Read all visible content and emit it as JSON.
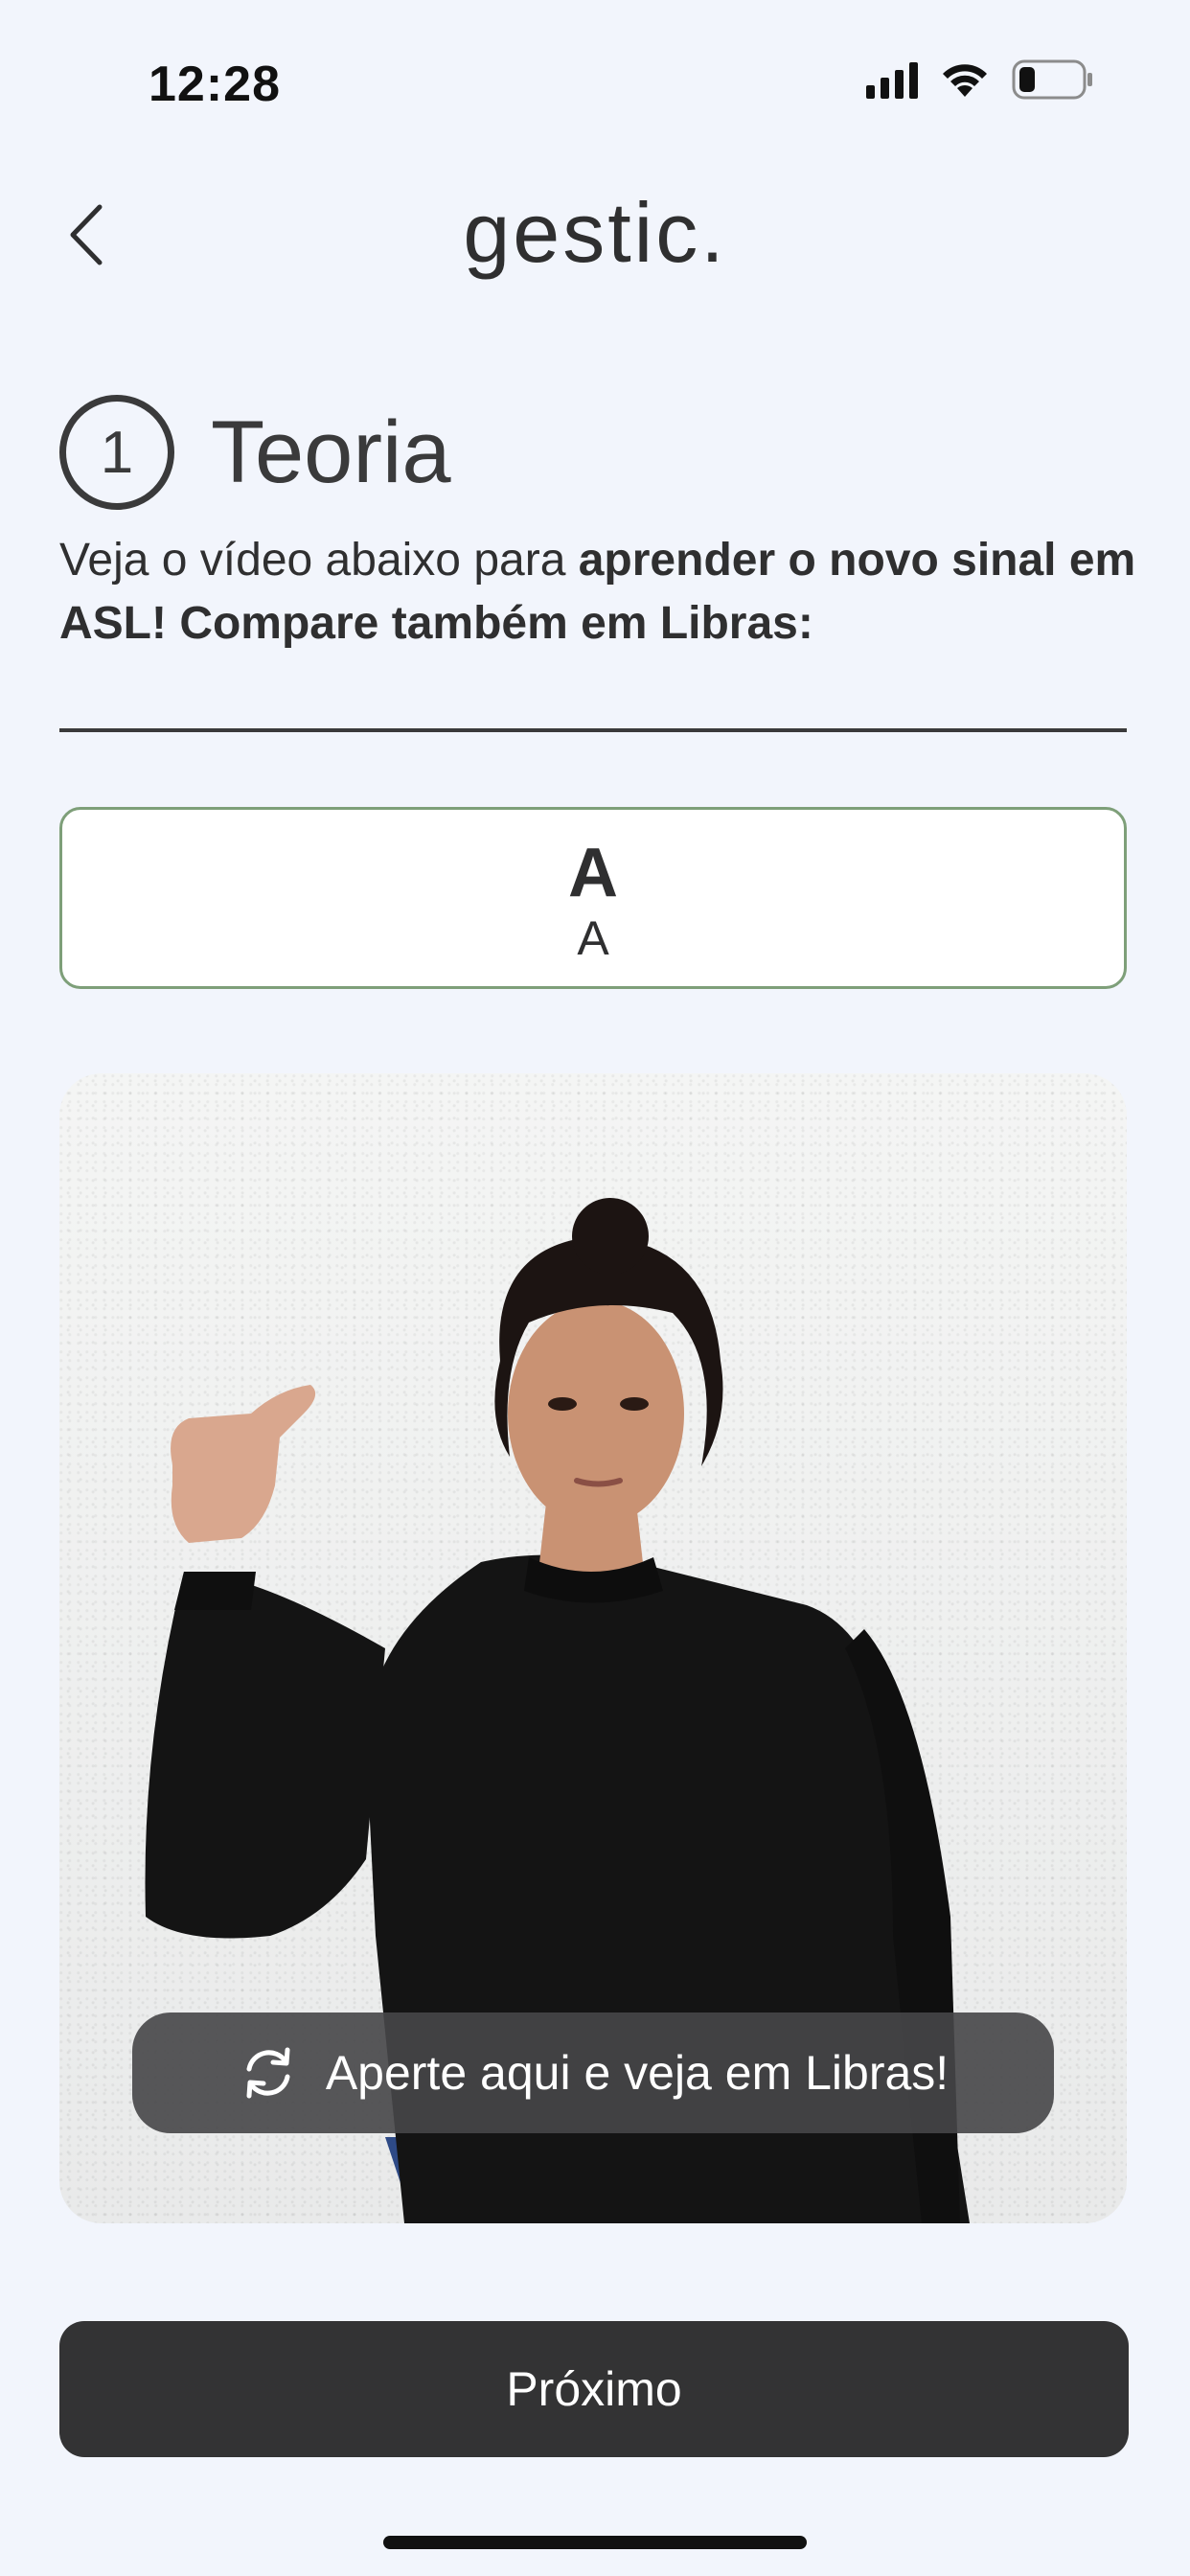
{
  "status_bar": {
    "time": "12:28"
  },
  "header": {
    "title": "gestic."
  },
  "section": {
    "step_number": "1",
    "title": "Teoria",
    "instruction_regular": "Veja o vídeo abaixo para ",
    "instruction_bold": "aprender o novo sinal em ASL! Compare também em Libras:"
  },
  "sign_card": {
    "asl_sign": "A",
    "libras_sign": "A"
  },
  "video": {
    "toggle_label": "Aperte aqui e veja em Libras!",
    "toggle_icon": "refresh-icon"
  },
  "footer": {
    "next_label": "Próximo"
  },
  "colors": {
    "background": "#f2f5fc",
    "card_border": "#7e9f79",
    "button": "#333334",
    "text": "#2f2f30"
  }
}
